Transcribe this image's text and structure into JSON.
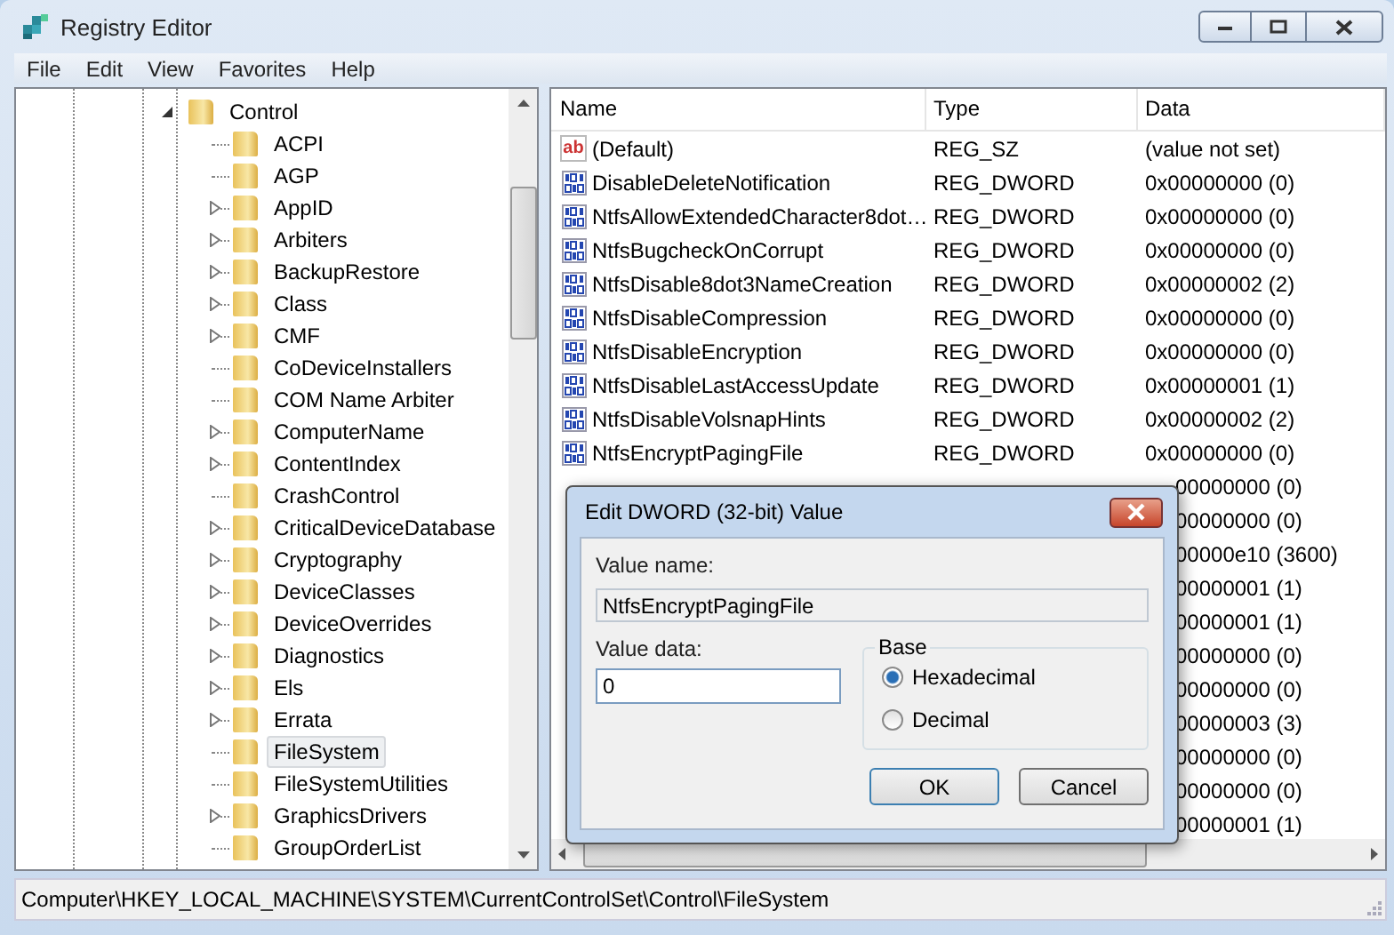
{
  "window": {
    "title": "Registry Editor"
  },
  "menu": [
    "File",
    "Edit",
    "View",
    "Favorites",
    "Help"
  ],
  "tree": {
    "label": "Control",
    "expanded": true,
    "children": [
      {
        "label": "ACPI",
        "expandable": false,
        "selected": false
      },
      {
        "label": "AGP",
        "expandable": false,
        "selected": false
      },
      {
        "label": "AppID",
        "expandable": true,
        "selected": false
      },
      {
        "label": "Arbiters",
        "expandable": true,
        "selected": false
      },
      {
        "label": "BackupRestore",
        "expandable": true,
        "selected": false
      },
      {
        "label": "Class",
        "expandable": true,
        "selected": false
      },
      {
        "label": "CMF",
        "expandable": true,
        "selected": false
      },
      {
        "label": "CoDeviceInstallers",
        "expandable": false,
        "selected": false
      },
      {
        "label": "COM Name Arbiter",
        "expandable": false,
        "selected": false
      },
      {
        "label": "ComputerName",
        "expandable": true,
        "selected": false
      },
      {
        "label": "ContentIndex",
        "expandable": true,
        "selected": false
      },
      {
        "label": "CrashControl",
        "expandable": false,
        "selected": false
      },
      {
        "label": "CriticalDeviceDatabase",
        "expandable": true,
        "selected": false
      },
      {
        "label": "Cryptography",
        "expandable": true,
        "selected": false
      },
      {
        "label": "DeviceClasses",
        "expandable": true,
        "selected": false
      },
      {
        "label": "DeviceOverrides",
        "expandable": true,
        "selected": false
      },
      {
        "label": "Diagnostics",
        "expandable": true,
        "selected": false
      },
      {
        "label": "Els",
        "expandable": true,
        "selected": false
      },
      {
        "label": "Errata",
        "expandable": true,
        "selected": false
      },
      {
        "label": "FileSystem",
        "expandable": false,
        "selected": true
      },
      {
        "label": "FileSystemUtilities",
        "expandable": false,
        "selected": false
      },
      {
        "label": "GraphicsDrivers",
        "expandable": true,
        "selected": false
      },
      {
        "label": "GroupOrderList",
        "expandable": false,
        "selected": false
      }
    ]
  },
  "table": {
    "columns": [
      "Name",
      "Type",
      "Data"
    ],
    "rows": [
      {
        "kind": "string",
        "icon_text": "ab",
        "name": "(Default)",
        "type": "REG_SZ",
        "data": "(value not set)"
      },
      {
        "kind": "dword",
        "name": "DisableDeleteNotification",
        "type": "REG_DWORD",
        "data": "0x00000000 (0)"
      },
      {
        "kind": "dword",
        "name": "NtfsAllowExtendedCharacter8dot…",
        "type": "REG_DWORD",
        "data": "0x00000000 (0)"
      },
      {
        "kind": "dword",
        "name": "NtfsBugcheckOnCorrupt",
        "type": "REG_DWORD",
        "data": "0x00000000 (0)"
      },
      {
        "kind": "dword",
        "name": "NtfsDisable8dot3NameCreation",
        "type": "REG_DWORD",
        "data": "0x00000002 (2)"
      },
      {
        "kind": "dword",
        "name": "NtfsDisableCompression",
        "type": "REG_DWORD",
        "data": "0x00000000 (0)"
      },
      {
        "kind": "dword",
        "name": "NtfsDisableEncryption",
        "type": "REG_DWORD",
        "data": "0x00000000 (0)"
      },
      {
        "kind": "dword",
        "name": "NtfsDisableLastAccessUpdate",
        "type": "REG_DWORD",
        "data": "0x00000001 (1)"
      },
      {
        "kind": "dword",
        "name": "NtfsDisableVolsnapHints",
        "type": "REG_DWORD",
        "data": "0x00000002 (2)"
      },
      {
        "kind": "dword",
        "name": "NtfsEncryptPagingFile",
        "type": "REG_DWORD",
        "data": "0x00000000 (0)"
      }
    ],
    "rows_behind_dialog": [
      {
        "data": "00000000 (0)"
      },
      {
        "data": "00000000 (0)"
      },
      {
        "data": "00000e10 (3600)"
      },
      {
        "data": "00000001 (1)"
      },
      {
        "data": "00000001 (1)"
      },
      {
        "data": "00000000 (0)"
      },
      {
        "data": "00000000 (0)"
      },
      {
        "data": "00000003 (3)"
      },
      {
        "data": "00000000 (0)"
      },
      {
        "data": "00000000 (0)"
      },
      {
        "data": "00000001 (1)"
      }
    ]
  },
  "dialog": {
    "title": "Edit DWORD (32-bit) Value",
    "value_name_label": "Value name:",
    "value_name": "NtfsEncryptPagingFile",
    "value_data_label": "Value data:",
    "value_data": "0",
    "base_label": "Base",
    "base_options": [
      {
        "label": "Hexadecimal",
        "selected": true
      },
      {
        "label": "Decimal",
        "selected": false
      }
    ],
    "buttons": [
      "OK",
      "Cancel"
    ]
  },
  "status_bar": "Computer\\HKEY_LOCAL_MACHINE\\SYSTEM\\CurrentControlSet\\Control\\FileSystem"
}
